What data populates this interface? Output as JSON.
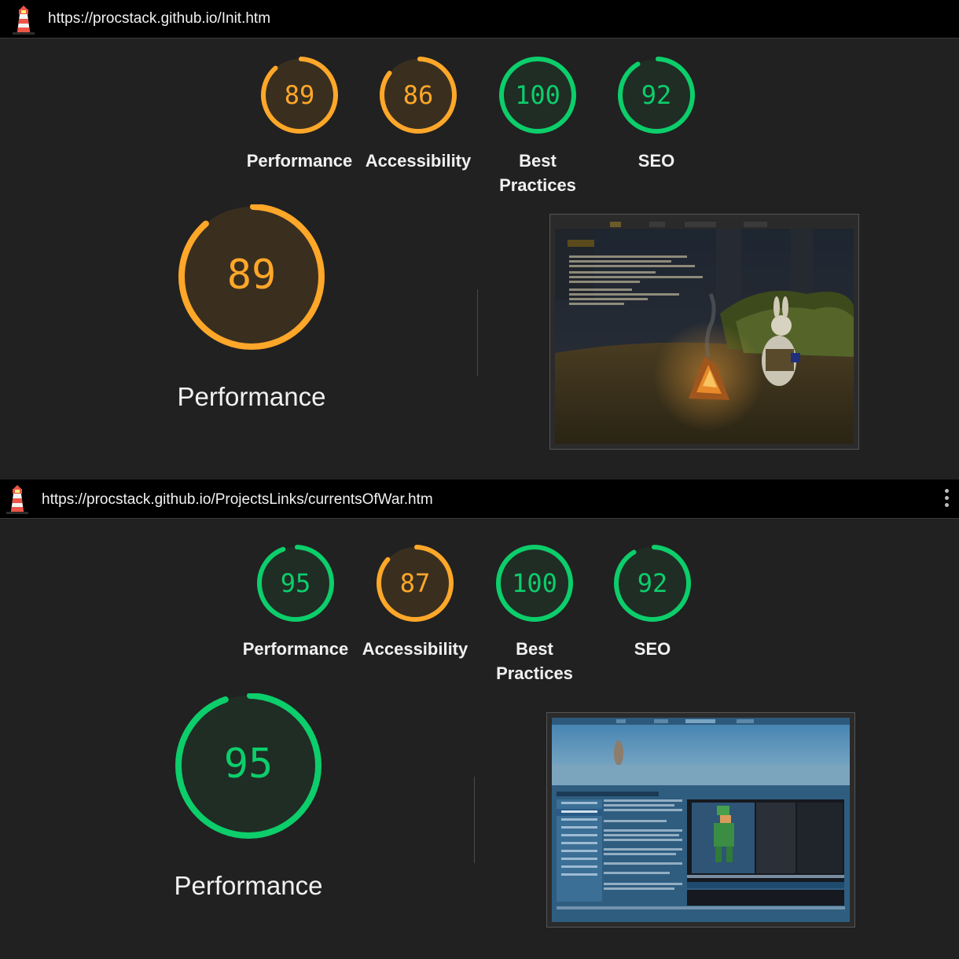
{
  "colors": {
    "pass": "#0cce6b",
    "average": "#ffa729",
    "pass_bg": "#1f2d24",
    "average_bg": "#3a2f1f",
    "panel": "#212121"
  },
  "reports": [
    {
      "url": "https://procstack.github.io/Init.htm",
      "scores": [
        {
          "label": "Performance",
          "value": "89",
          "rating": "average"
        },
        {
          "label": "Accessibility",
          "value": "86",
          "rating": "average"
        },
        {
          "label": "Best Practices",
          "value": "100",
          "rating": "pass"
        },
        {
          "label": "SEO",
          "value": "92",
          "rating": "pass"
        }
      ],
      "focus": {
        "label": "Performance",
        "value": "89",
        "rating": "average"
      },
      "screenshot": {
        "nav": [
          "Init",
          "pxlNav",
          "Repos / Projects",
          "About Me"
        ],
        "greeting": "Ahoi there!"
      }
    },
    {
      "url": "https://procstack.github.io/ProjectsLinks/currentsOfWar.htm",
      "scores": [
        {
          "label": "Performance",
          "value": "95",
          "rating": "pass"
        },
        {
          "label": "Accessibility",
          "value": "87",
          "rating": "average"
        },
        {
          "label": "Best Practices",
          "value": "100",
          "rating": "pass"
        },
        {
          "label": "SEO",
          "value": "92",
          "rating": "pass"
        }
      ],
      "focus": {
        "label": "Performance",
        "value": "95",
        "rating": "pass"
      },
      "screenshot": {
        "nav": [
          "Init",
          "pxlNav",
          "Repos / Projects",
          "About Me"
        ],
        "heading": "My Repos / Projects / Socials",
        "footer": [
          "Socials",
          "YouTube",
          "Instagram",
          "GitHub"
        ]
      }
    }
  ]
}
